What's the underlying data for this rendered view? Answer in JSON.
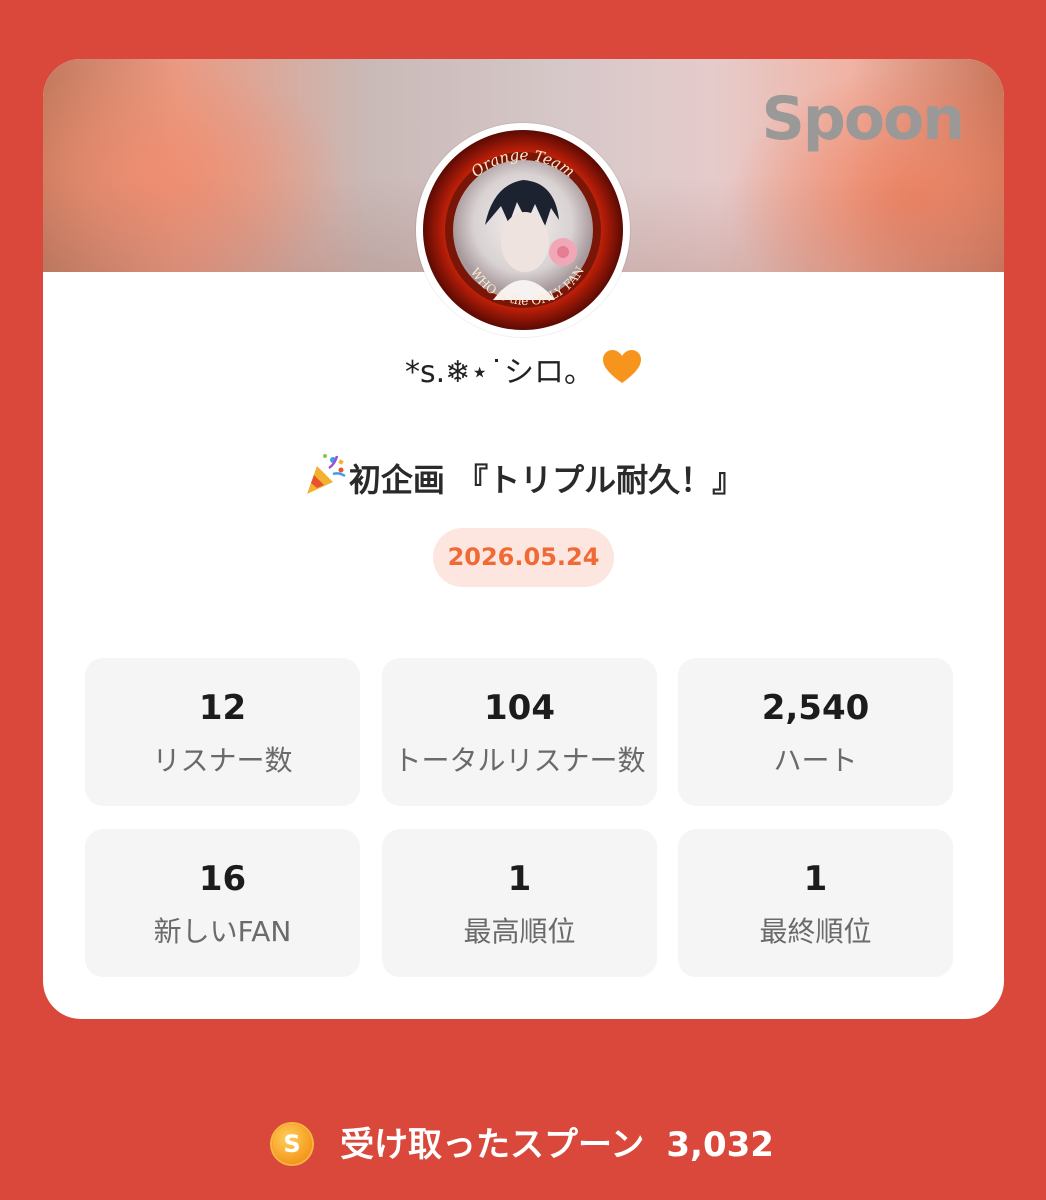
{
  "brand": "Spoon",
  "avatar": {
    "ring_text_top": "Orange Team",
    "ring_text_bottom": "WHO is the ONLY FAN"
  },
  "profile": {
    "username": "*s.❄⋆˙シロ。",
    "emoji": "orange-heart-icon"
  },
  "event": {
    "emoji": "party-popper-icon",
    "title": "初企画 『トリプル耐久！』",
    "date": "2026.05.24"
  },
  "stats": [
    {
      "value": "12",
      "label": "リスナー数"
    },
    {
      "value": "104",
      "label": "トータルリスナー数"
    },
    {
      "value": "2,540",
      "label": "ハート"
    },
    {
      "value": "16",
      "label": "新しいFAN"
    },
    {
      "value": "1",
      "label": "最高順位"
    },
    {
      "value": "1",
      "label": "最終順位"
    }
  ],
  "footer": {
    "icon": "spoon-coin-icon",
    "icon_letter": "S",
    "label": "受け取ったスプーン",
    "amount": "3,032"
  },
  "colors": {
    "background": "#d9483a",
    "accent": "#f06a35",
    "date_pill_bg": "#fde6e0"
  }
}
